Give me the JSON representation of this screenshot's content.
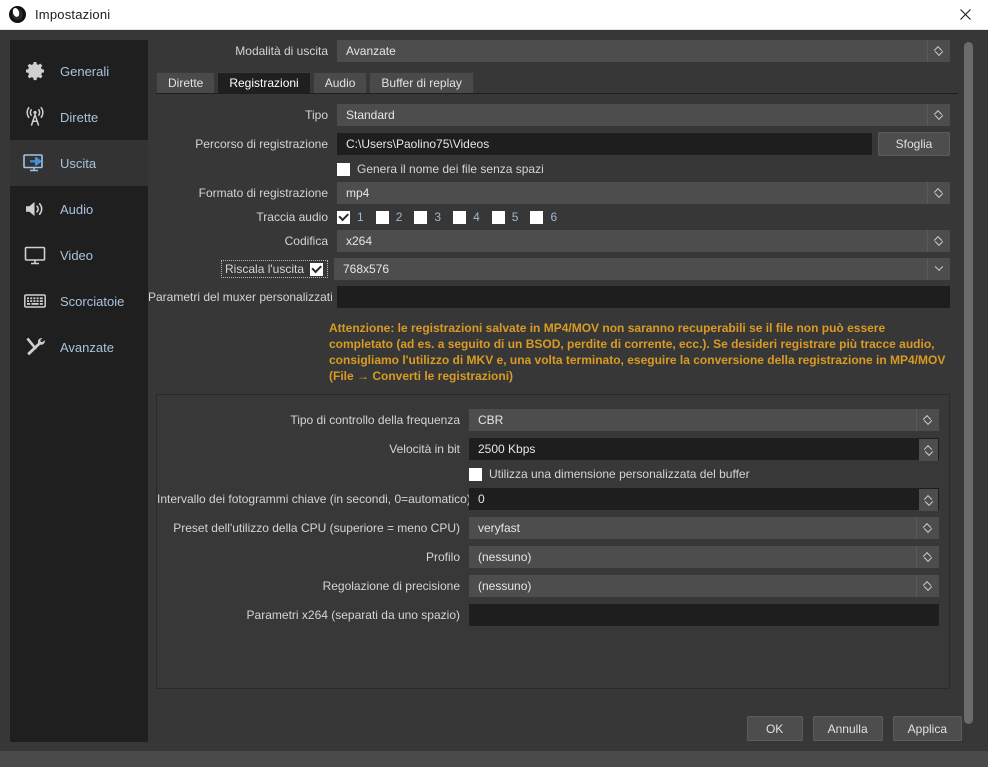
{
  "window": {
    "title": "Impostazioni",
    "logo_icon": "obs-logo-icon",
    "close_icon": "close-icon"
  },
  "sidebar": {
    "items": [
      {
        "label": "Generali",
        "icon": "gear-icon",
        "selected": false
      },
      {
        "label": "Dirette",
        "icon": "broadcast-icon",
        "selected": false
      },
      {
        "label": "Uscita",
        "icon": "output-monitor-icon",
        "selected": true
      },
      {
        "label": "Audio",
        "icon": "speaker-icon",
        "selected": false
      },
      {
        "label": "Video",
        "icon": "monitor-icon",
        "selected": false
      },
      {
        "label": "Scorciatoie",
        "icon": "keyboard-icon",
        "selected": false
      },
      {
        "label": "Avanzate",
        "icon": "tools-icon",
        "selected": false
      }
    ]
  },
  "output_mode": {
    "label": "Modalità di uscita",
    "value": "Avanzate"
  },
  "tabs": [
    {
      "label": "Dirette",
      "active": false
    },
    {
      "label": "Registrazioni",
      "active": true
    },
    {
      "label": "Audio",
      "active": false
    },
    {
      "label": "Buffer di replay",
      "active": false
    }
  ],
  "recording": {
    "type": {
      "label": "Tipo",
      "value": "Standard"
    },
    "path": {
      "label": "Percorso di registrazione",
      "value": "C:\\Users\\Paolino75\\Videos",
      "browse_label": "Sfoglia"
    },
    "no_space": {
      "label": "Genera il nome dei file senza spazi",
      "checked": false
    },
    "format": {
      "label": "Formato di registrazione",
      "value": "mp4"
    },
    "audio_track": {
      "label": "Traccia audio",
      "tracks": [
        {
          "num": "1",
          "checked": true
        },
        {
          "num": "2",
          "checked": false
        },
        {
          "num": "3",
          "checked": false
        },
        {
          "num": "4",
          "checked": false
        },
        {
          "num": "5",
          "checked": false
        },
        {
          "num": "6",
          "checked": false
        }
      ]
    },
    "encoder": {
      "label": "Codifica",
      "value": "x264"
    },
    "rescale": {
      "label": "Riscala l'uscita",
      "checked": true,
      "value": "768x576",
      "focused": true
    },
    "muxer": {
      "label": "Parametri del muxer personalizzati",
      "value": ""
    },
    "warning": "Attenzione: le registrazioni salvate in MP4/MOV non saranno recuperabili se il file non può essere completato (ad es. a seguito di un BSOD, perdite di corrente, ecc.). Se desideri registrare più tracce audio, consigliamo l'utilizzo di MKV e, una volta terminato, eseguire la conversione della registrazione in MP4/MOV (File → Converti le registrazioni)"
  },
  "encoder_settings": {
    "rate_control": {
      "label": "Tipo di controllo della frequenza",
      "value": "CBR"
    },
    "bitrate": {
      "label": "Velocità in bit",
      "value": "2500 Kbps"
    },
    "custom_buffer": {
      "label": "Utilizza una dimensione personalizzata del buffer",
      "checked": false
    },
    "keyframe_interval": {
      "label": "Intervallo dei fotogrammi chiave (in secondi, 0=automatico)",
      "value": "0"
    },
    "cpu_preset": {
      "label": "Preset dell'utilizzo della CPU (superiore = meno CPU)",
      "value": "veryfast"
    },
    "profile": {
      "label": "Profilo",
      "value": "(nessuno)"
    },
    "tune": {
      "label": "Regolazione di precisione",
      "value": "(nessuno)"
    },
    "x264_opts": {
      "label": "Parametri x264 (separati da uno spazio)",
      "value": ""
    }
  },
  "footer": {
    "ok": "OK",
    "cancel": "Annulla",
    "apply": "Applica"
  },
  "colors": {
    "accent_warning": "#d99b24",
    "window_bg": "#373737",
    "sidebar_bg": "#1f1f1f",
    "sidebar_text": "#a9c3dd"
  }
}
